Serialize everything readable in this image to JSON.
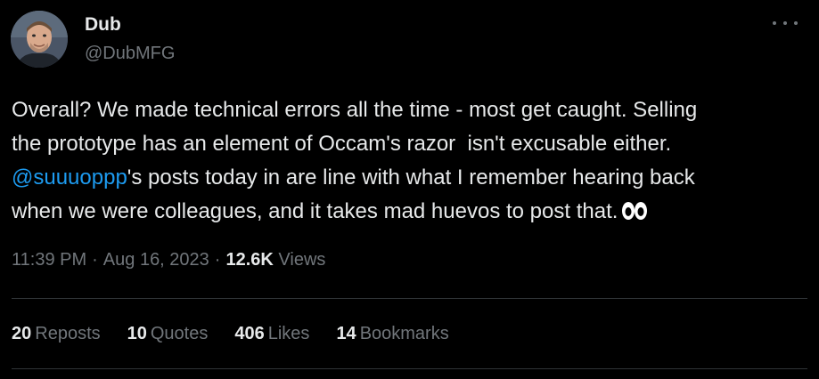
{
  "author": {
    "display_name": "Dub",
    "handle": "@DubMFG",
    "avatar_icon": "profile-photo"
  },
  "more_icon": "ellipsis-icon",
  "tweet": {
    "line1": "Overall? We made technical errors all the time - most get caught. Selling",
    "line2": "the prototype has an element of Occam's razor  isn't excusable either.",
    "mention": "@suuuoppp",
    "line3_rest": "'s posts today in are line with what I remember hearing back",
    "line4": "when we were colleagues, and it takes mad huevos to post that.",
    "emoji": "eyes-emoji"
  },
  "meta": {
    "time": "11:39 PM",
    "separator": "·",
    "date": "Aug 16, 2023",
    "views_count": "12.6K",
    "views_label": "Views"
  },
  "stats": [
    {
      "count": "20",
      "label": "Reposts"
    },
    {
      "count": "10",
      "label": "Quotes"
    },
    {
      "count": "406",
      "label": "Likes"
    },
    {
      "count": "14",
      "label": "Bookmarks"
    }
  ],
  "colors": {
    "background": "#000000",
    "text": "#e7e9ea",
    "secondary": "#71767b",
    "link": "#1d9bf0",
    "divider": "#2f3336"
  }
}
